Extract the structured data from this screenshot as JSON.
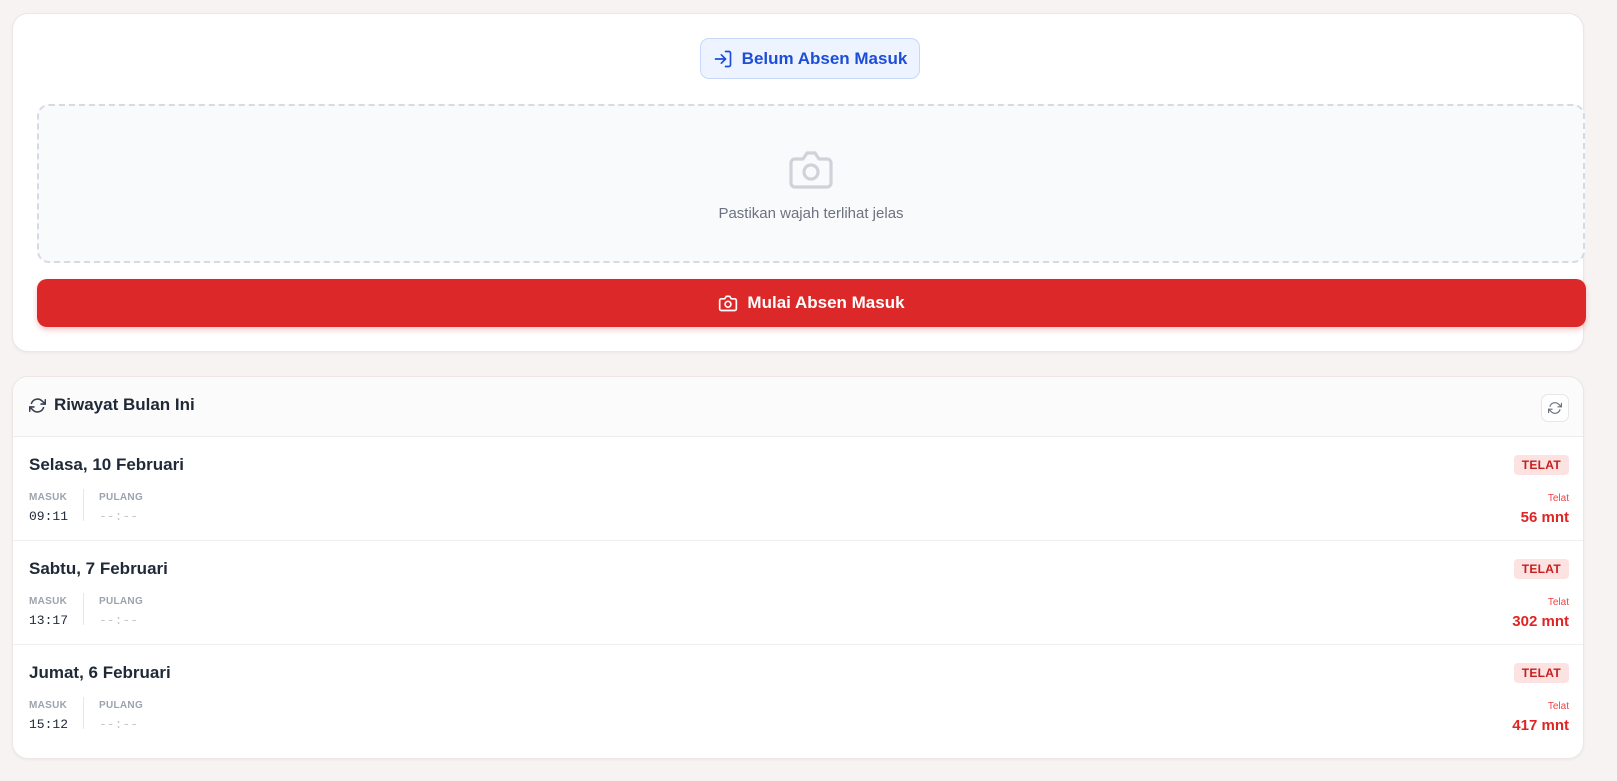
{
  "status": {
    "label": "Belum Absen Masuk",
    "icon": "login-icon"
  },
  "camera": {
    "hint": "Pastikan wajah terlihat jelas",
    "icon": "camera-icon"
  },
  "start_button": {
    "label": "Mulai Absen Masuk",
    "icon": "camera-icon"
  },
  "history": {
    "title": "Riwayat Bulan Ini",
    "icon": "refresh-icon",
    "records": [
      {
        "date": "Selasa, 10 Februari",
        "badge": "TELAT",
        "in_label": "MASUK",
        "in_time": "09:11",
        "out_label": "PULANG",
        "out_time": "--:--",
        "late_label": "Telat",
        "late_value": "56 mnt"
      },
      {
        "date": "Sabtu, 7 Februari",
        "badge": "TELAT",
        "in_label": "MASUK",
        "in_time": "13:17",
        "out_label": "PULANG",
        "out_time": "--:--",
        "late_label": "Telat",
        "late_value": "302 mnt"
      },
      {
        "date": "Jumat, 6 Februari",
        "badge": "TELAT",
        "in_label": "MASUK",
        "in_time": "15:12",
        "out_label": "PULANG",
        "out_time": "--:--",
        "late_label": "Telat",
        "late_value": "417 mnt"
      }
    ]
  },
  "colors": {
    "primary_red": "#dc2828",
    "info_blue": "#1d4ed8",
    "late_red": "#e02424",
    "page_bg": "#f8f3f3"
  }
}
